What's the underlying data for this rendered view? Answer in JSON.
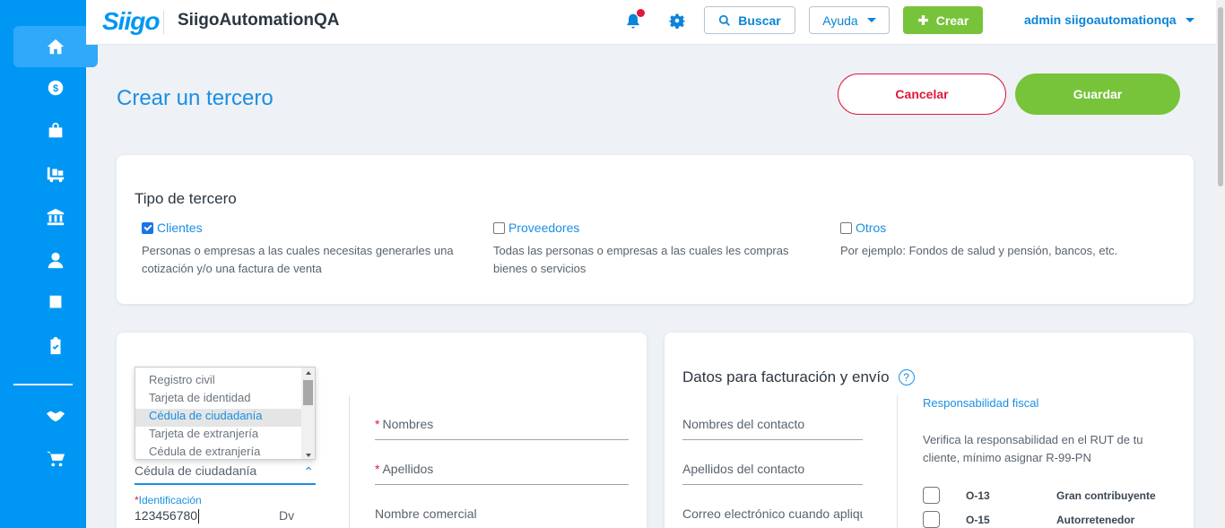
{
  "app": {
    "logo_text": "Siigo",
    "company_name": "SiigoAutomationQA"
  },
  "topbar": {
    "search_label": "Buscar",
    "help_label": "Ayuda",
    "create_label": "Crear",
    "user_label": "admin siigoautomationqa"
  },
  "sidebar": {
    "items": [
      {
        "icon": "home-icon",
        "active": true
      },
      {
        "icon": "dollar-icon"
      },
      {
        "icon": "shopping-bag-icon"
      },
      {
        "icon": "cart-forklift-icon"
      },
      {
        "icon": "bank-icon"
      },
      {
        "icon": "user-icon"
      },
      {
        "icon": "book-icon"
      },
      {
        "icon": "clipboard-check-icon"
      },
      {
        "icon": "handshake-icon"
      },
      {
        "icon": "shopping-cart-icon"
      }
    ]
  },
  "page": {
    "title": "Crear un tercero",
    "cancel_label": "Cancelar",
    "save_label": "Guardar"
  },
  "tipo_tercero": {
    "heading": "Tipo de tercero",
    "options": [
      {
        "label": "Clientes",
        "checked": true,
        "description": "Personas o empresas a las cuales necesitas generarles una cotización y/o una factura de venta"
      },
      {
        "label": "Proveedores",
        "checked": false,
        "description": "Todas las personas o empresas a las cuales les compras bienes o servicios"
      },
      {
        "label": "Otros",
        "checked": false,
        "description": "Por ejemplo: Fondos de salud y pensión, bancos, etc."
      }
    ]
  },
  "identificacion": {
    "document_type_value": "Cédula de ciudadanía",
    "dropdown_options": [
      "Registro civil",
      "Tarjeta de identidad",
      "Cédula de ciudadanía",
      "Tarjeta de extranjería",
      "Cédula de extranjería"
    ],
    "selected_option": "Cédula de ciudadanía",
    "id_label_required": "*",
    "id_label": "Identificación",
    "id_value": "123456780",
    "dv_label": "Dv",
    "nombres_label": "Nombres",
    "apellidos_label": "Apellidos",
    "nombre_comercial_label": "Nombre comercial",
    "required_mark": "*"
  },
  "facturacion": {
    "heading": "Datos para facturación y envío",
    "help_symbol": "?",
    "contact_name_placeholder": "Nombres del contacto",
    "contact_lastname_placeholder": "Apellidos del contacto",
    "email_placeholder": "Correo electrónico cuando aplique",
    "resp_title": "Responsabilidad fiscal",
    "resp_desc": "Verifica la responsabilidad en el RUT de tu cliente, mínimo asignar R-99-PN",
    "responsibilities": [
      {
        "code": "O-13",
        "name": "Gran contribuyente"
      },
      {
        "code": "O-15",
        "name": "Autorretenedor"
      }
    ]
  },
  "colors": {
    "brand_blue": "#0097f4",
    "link_blue": "#1a8fe3",
    "green": "#77c33a",
    "danger": "#e0173d"
  }
}
